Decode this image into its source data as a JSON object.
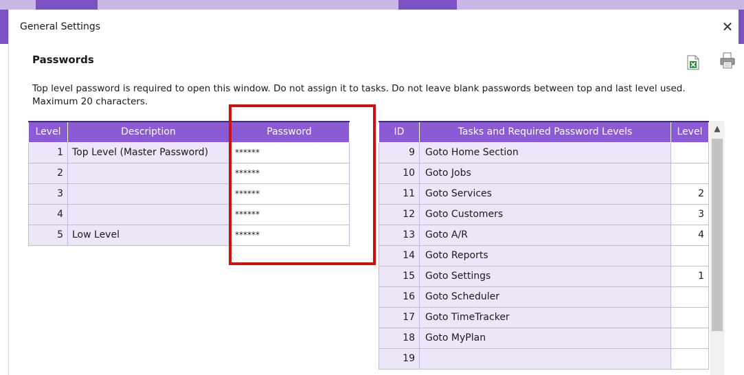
{
  "window": {
    "title": "General Settings",
    "close_label": "✕"
  },
  "section": {
    "title": "Passwords",
    "instructions": "Top level password is required to open this window. Do not assign it to tasks. Do not leave blank passwords between top and last level used. Maximum 20 characters."
  },
  "toolbar": {
    "excel_icon": "excel-export-icon",
    "print_icon": "print-icon"
  },
  "password_table": {
    "headers": [
      "Level",
      "Description",
      "Password"
    ],
    "rows": [
      {
        "level": "1",
        "description": "Top Level (Master Password)",
        "password": "******"
      },
      {
        "level": "2",
        "description": "",
        "password": "******"
      },
      {
        "level": "3",
        "description": "",
        "password": "******"
      },
      {
        "level": "4",
        "description": "",
        "password": "******"
      },
      {
        "level": "5",
        "description": "Low Level",
        "password": "******"
      }
    ]
  },
  "task_table": {
    "headers": [
      "ID",
      "Tasks and Required Password Levels",
      "Level"
    ],
    "rows": [
      {
        "id": "9",
        "task": "Goto Home Section",
        "level": ""
      },
      {
        "id": "10",
        "task": "Goto Jobs",
        "level": ""
      },
      {
        "id": "11",
        "task": "Goto Services",
        "level": "2"
      },
      {
        "id": "12",
        "task": "Goto Customers",
        "level": "3"
      },
      {
        "id": "13",
        "task": "Goto A/R",
        "level": "4"
      },
      {
        "id": "14",
        "task": "Goto Reports",
        "level": ""
      },
      {
        "id": "15",
        "task": "Goto Settings",
        "level": "1"
      },
      {
        "id": "16",
        "task": "Goto Scheduler",
        "level": ""
      },
      {
        "id": "17",
        "task": "Goto TimeTracker",
        "level": ""
      },
      {
        "id": "18",
        "task": "Goto MyPlan",
        "level": ""
      },
      {
        "id": "19",
        "task": "",
        "level": ""
      }
    ]
  },
  "colors": {
    "header_purple": "#8a5bd3",
    "row_lavender": "#ece6f8",
    "highlight_red": "#cc1111"
  }
}
